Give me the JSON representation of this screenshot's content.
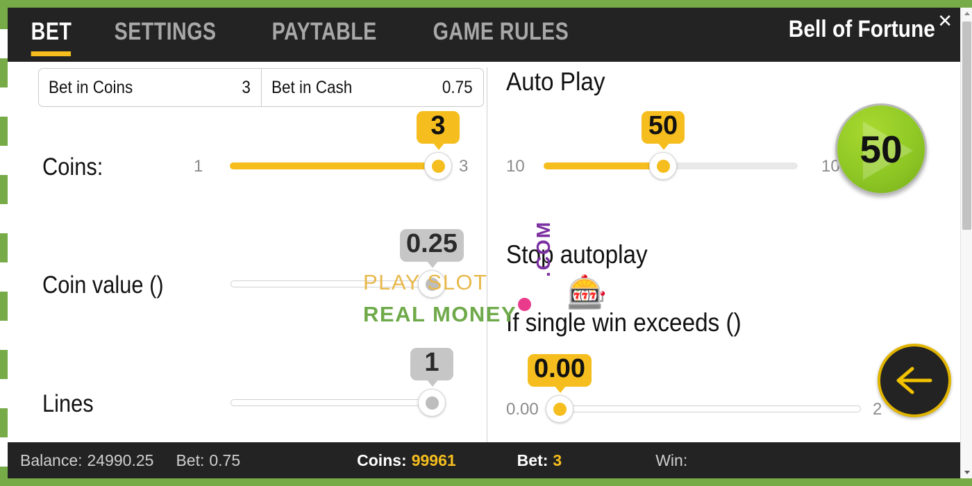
{
  "window": {
    "game_title": "Bell of Fortune",
    "close_icon": "close-icon"
  },
  "tabs": [
    {
      "label": "BET",
      "active": true
    },
    {
      "label": "SETTINGS",
      "active": false
    },
    {
      "label": "PAYTABLE",
      "active": false
    },
    {
      "label": "GAME RULES",
      "active": false
    }
  ],
  "bet_summary": {
    "coins": {
      "label": "Bet in Coins",
      "value": "3"
    },
    "cash": {
      "label": "Bet in Cash",
      "value": "0.75"
    }
  },
  "left_panel": {
    "coins_slider": {
      "label": "Coins:",
      "min_label": "1",
      "max_label": "3",
      "value": "3",
      "percent": 100,
      "enabled": true
    },
    "coin_value_slider": {
      "label": "Coin value ()",
      "min_label": "",
      "max_label": "",
      "value": "0.25",
      "percent": 100,
      "enabled": false
    },
    "lines_slider": {
      "label": "Lines",
      "min_label": "",
      "max_label": "",
      "value": "1",
      "percent": 100,
      "enabled": false
    }
  },
  "right_panel": {
    "autoplay": {
      "title": "Auto Play",
      "min_label": "10",
      "max_label": "100",
      "value": "50",
      "percent": 47,
      "enabled": true
    },
    "stop_autoplay": {
      "title": "Stop autoplay"
    },
    "single_win": {
      "title": "If single win exceeds ()",
      "min_label": "0.00",
      "max_label": "2",
      "value": "0.00",
      "percent": 0,
      "enabled": true
    },
    "spin_button": {
      "count": "50",
      "icon": "play-triangle-icon"
    },
    "back_button": {
      "icon": "arrow-left-icon"
    }
  },
  "watermark": {
    "line1": "PLAY SLOT",
    "line2": "REAL MONEY",
    "com": ".COM",
    "dot_color": "#ea3a8c",
    "slot_icon": "slot-machine-icon"
  },
  "status_bar": {
    "balance_label": "Balance:",
    "balance_value": "24990.25",
    "bet_cash_label": "Bet:",
    "bet_cash_value": "0.75",
    "coins_label": "Coins:",
    "coins_value": "99961",
    "bet_label": "Bet:",
    "bet_value": "3",
    "win_label": "Win:",
    "win_value": ""
  },
  "colors": {
    "accent_gold": "#f5be1e",
    "topbar": "#232323",
    "spin_green": "#8fc825",
    "checker_green": "#77ab48"
  },
  "scrollbar": {
    "up_icon": "scroll-up-arrow-icon",
    "down_icon": "scroll-down-arrow-icon"
  }
}
